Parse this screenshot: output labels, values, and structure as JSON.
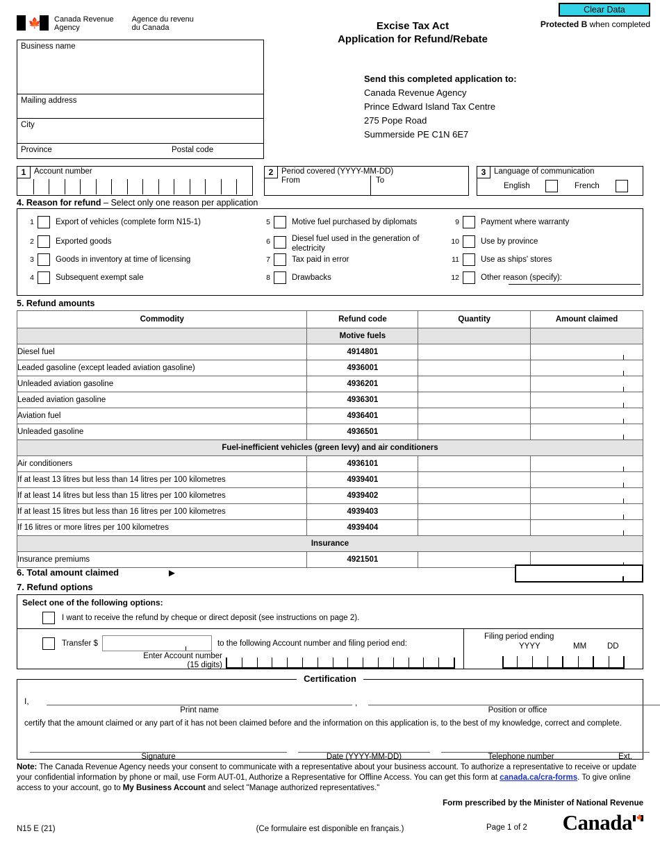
{
  "header": {
    "clear_data_label": "Clear Data",
    "protected_bold": "Protected B",
    "protected_rest": " when completed",
    "agency_en": "Canada Revenue\nAgency",
    "agency_en_line1": "Canada Revenue",
    "agency_en_line2": "Agency",
    "agency_fr_line1": "Agence du revenu",
    "agency_fr_line2": "du Canada",
    "title_line1": "Excise Tax Act",
    "title_line2": "Application for Refund/Rebate",
    "maple_leaf_icon": "maple-leaf-icon"
  },
  "identification": {
    "business_name_label": "Business name",
    "mailing_address_label": "Mailing address",
    "city_label": "City",
    "province_label": "Province",
    "postal_code_label": "Postal code"
  },
  "send_to": {
    "heading": "Send this completed application to:",
    "lines": [
      "Canada Revenue Agency",
      "Prince Edward Island Tax Centre",
      "275 Pope Road",
      "Summerside PE  C1N 6E7"
    ]
  },
  "field1": {
    "number": "1",
    "label": "Account number",
    "cells": 15
  },
  "field2": {
    "number": "2",
    "label": "Period covered (YYYY-MM-DD)",
    "from_label": "From",
    "to_label": "To",
    "from_value": "",
    "to_value": ""
  },
  "field3": {
    "number": "3",
    "label": "Language of communication",
    "english_label": "English",
    "french_label": "French"
  },
  "section4": {
    "heading_bold": "4. Reason for refund",
    "heading_rest": " – Select only one reason per application",
    "reasons": [
      {
        "num": "1",
        "label": "Export of vehicles (complete form N15-1)"
      },
      {
        "num": "2",
        "label": "Exported goods"
      },
      {
        "num": "3",
        "label": "Goods in inventory at time of licensing"
      },
      {
        "num": "4",
        "label": "Subsequent exempt sale"
      },
      {
        "num": "5",
        "label": "Motive fuel purchased by diplomats"
      },
      {
        "num": "6",
        "label": "Diesel fuel used in the generation of electricity"
      },
      {
        "num": "7",
        "label": "Tax paid in error"
      },
      {
        "num": "8",
        "label": "Drawbacks"
      },
      {
        "num": "9",
        "label": "Payment where warranty"
      },
      {
        "num": "10",
        "label": "Use by province"
      },
      {
        "num": "11",
        "label": "Use as ships' stores"
      },
      {
        "num": "12",
        "label": "Other reason (specify):"
      }
    ]
  },
  "section5": {
    "heading": "5. Refund amounts",
    "columns": [
      "Commodity",
      "Refund code",
      "Quantity",
      "Amount claimed"
    ],
    "groups": [
      {
        "title": "Motive fuels",
        "rows": [
          {
            "commodity": "Diesel fuel",
            "code": "4914801",
            "quantity": "",
            "amount": ""
          },
          {
            "commodity": "Leaded gasoline (except leaded aviation gasoline)",
            "code": "4936001",
            "quantity": "",
            "amount": ""
          },
          {
            "commodity": "Unleaded aviation gasoline",
            "code": "4936201",
            "quantity": "",
            "amount": ""
          },
          {
            "commodity": "Leaded aviation gasoline",
            "code": "4936301",
            "quantity": "",
            "amount": ""
          },
          {
            "commodity": "Aviation fuel",
            "code": "4936401",
            "quantity": "",
            "amount": ""
          },
          {
            "commodity": "Unleaded gasoline",
            "code": "4936501",
            "quantity": "",
            "amount": ""
          }
        ]
      },
      {
        "title": "Fuel-inefficient vehicles (green levy) and air conditioners",
        "rows": [
          {
            "commodity": "Air conditioners",
            "code": "4936101",
            "quantity": "",
            "amount": ""
          },
          {
            "commodity": "If at least 13 litres but less than 14 litres per 100 kilometres",
            "code": "4939401",
            "quantity": "",
            "amount": ""
          },
          {
            "commodity": "If at least 14 litres but less than 15 litres per 100 kilometres",
            "code": "4939402",
            "quantity": "",
            "amount": ""
          },
          {
            "commodity": "If at least 15 litres but less than 16 litres per 100 kilometres",
            "code": "4939403",
            "quantity": "",
            "amount": ""
          },
          {
            "commodity": "If 16 litres or more litres per 100 kilometres",
            "code": "4939404",
            "quantity": "",
            "amount": ""
          }
        ]
      },
      {
        "title": "Insurance",
        "rows": [
          {
            "commodity": "Insurance premiums",
            "code": "4921501",
            "quantity": "",
            "amount": ""
          }
        ]
      }
    ]
  },
  "section6": {
    "heading": "6. Total amount claimed",
    "arrow_icon": "right-triangle-icon",
    "total_value": ""
  },
  "section7": {
    "heading": "7. Refund options",
    "select_label": "Select one of the following options:",
    "option_cheque": "I want to receive the refund by cheque or direct deposit (see instructions on page 2).",
    "transfer_label": "Transfer $",
    "transfer_value": "",
    "transfer_rest": "to the following Account number and filing period end:",
    "enter_account_line1": "Enter Account number",
    "enter_account_line2": "(15 digits)",
    "account_cells": 15,
    "filing_period_label": "Filing period ending",
    "yyyy_label": "YYYY",
    "mm_label": "MM",
    "dd_label": "DD"
  },
  "certification": {
    "legend": "Certification",
    "i_label": "I,",
    "comma": ",",
    "print_name_caption": "Print name",
    "position_caption": "Position or office",
    "body": "certify that the amount claimed or any part of it has not been claimed before and the information on this application is, to the best of my knowledge, correct and complete.",
    "signature_caption": "Signature",
    "date_caption": "Date (YYYY-MM-DD)",
    "telephone_caption": "Telephone number",
    "ext_caption": "Ext.",
    "print_name_value": "",
    "position_value": ""
  },
  "note": {
    "label": "Note:",
    "part1": "The Canada Revenue Agency needs your consent to communicate with a representative about your business account. To authorize a representative to receive or update your confidential information by phone or mail, use Form AUT-01, Authorize a Representative for Offline Access. You can get this form at ",
    "link": "canada.ca/cra-forms",
    "part2": ". To give online access to your account, go to ",
    "bold2": "My Business Account",
    "part3": " and select \"Manage authorized representatives.\""
  },
  "footer": {
    "prescribed": "Form prescribed by the Minister of National Revenue",
    "form_number": "N15 E (21)",
    "french_notice": "(Ce formulaire est disponible en français.)",
    "page": "Page 1 of 2",
    "wordmark": "Canada"
  },
  "colors": {
    "clear_button_bg": "#34d4e8",
    "group_row_bg": "#e4e4e4",
    "link": "#1a32c8",
    "maple_red": "#d52b1e"
  }
}
